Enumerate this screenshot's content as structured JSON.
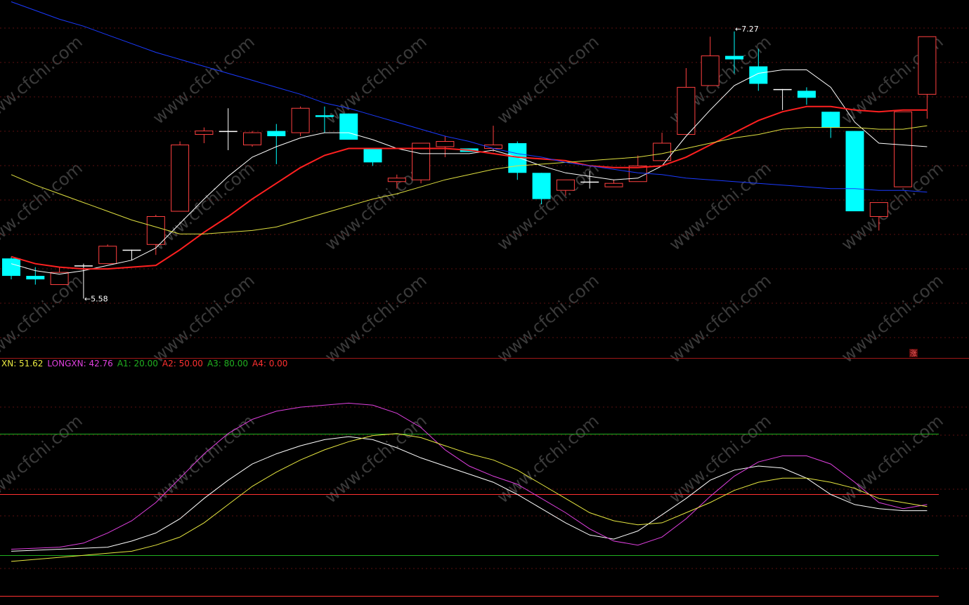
{
  "chart_data": [
    {
      "type": "candlestick",
      "title": "",
      "ylim": [
        5.4,
        7.45
      ],
      "candles": [
        {
          "o": 5.97,
          "h": 5.98,
          "l": 5.85,
          "c": 5.87
        },
        {
          "o": 5.87,
          "h": 5.92,
          "l": 5.82,
          "c": 5.85
        },
        {
          "o": 5.82,
          "h": 5.92,
          "l": 5.82,
          "c": 5.89
        },
        {
          "o": 5.93,
          "h": 5.94,
          "l": 5.74,
          "c": 5.93
        },
        {
          "o": 5.94,
          "h": 6.05,
          "l": 5.94,
          "c": 6.04
        },
        {
          "o": 6.02,
          "h": 6.02,
          "l": 5.96,
          "c": 6.02
        },
        {
          "o": 6.05,
          "h": 6.22,
          "l": 5.99,
          "c": 6.21
        },
        {
          "o": 6.24,
          "h": 6.64,
          "l": 6.24,
          "c": 6.62
        },
        {
          "o": 6.68,
          "h": 6.72,
          "l": 6.63,
          "c": 6.7
        },
        {
          "o": 6.7,
          "h": 6.83,
          "l": 6.59,
          "c": 6.7
        },
        {
          "o": 6.62,
          "h": 6.7,
          "l": 6.61,
          "c": 6.69
        },
        {
          "o": 6.7,
          "h": 6.74,
          "l": 6.51,
          "c": 6.67
        },
        {
          "o": 6.69,
          "h": 6.84,
          "l": 6.67,
          "c": 6.83
        },
        {
          "o": 6.79,
          "h": 6.84,
          "l": 6.69,
          "c": 6.78
        },
        {
          "o": 6.8,
          "h": 6.8,
          "l": 6.65,
          "c": 6.65
        },
        {
          "o": 6.6,
          "h": 6.6,
          "l": 6.5,
          "c": 6.52
        },
        {
          "o": 6.41,
          "h": 6.45,
          "l": 6.37,
          "c": 6.43
        },
        {
          "o": 6.42,
          "h": 6.63,
          "l": 6.4,
          "c": 6.63
        },
        {
          "o": 6.61,
          "h": 6.67,
          "l": 6.55,
          "c": 6.64
        },
        {
          "o": 6.6,
          "h": 6.6,
          "l": 6.58,
          "c": 6.58
        },
        {
          "o": 6.6,
          "h": 6.73,
          "l": 6.58,
          "c": 6.62
        },
        {
          "o": 6.63,
          "h": 6.64,
          "l": 6.42,
          "c": 6.46
        },
        {
          "o": 6.46,
          "h": 6.46,
          "l": 6.28,
          "c": 6.31
        },
        {
          "o": 6.36,
          "h": 6.42,
          "l": 6.33,
          "c": 6.42
        },
        {
          "o": 6.41,
          "h": 6.47,
          "l": 6.37,
          "c": 6.41
        },
        {
          "o": 6.38,
          "h": 6.42,
          "l": 6.38,
          "c": 6.4
        },
        {
          "o": 6.41,
          "h": 6.56,
          "l": 6.41,
          "c": 6.5
        },
        {
          "o": 6.53,
          "h": 6.69,
          "l": 6.53,
          "c": 6.63
        },
        {
          "o": 6.68,
          "h": 7.06,
          "l": 6.68,
          "c": 6.95
        },
        {
          "o": 6.96,
          "h": 7.24,
          "l": 6.96,
          "c": 7.13
        },
        {
          "o": 7.13,
          "h": 7.27,
          "l": 7.03,
          "c": 7.11
        },
        {
          "o": 7.07,
          "h": 7.17,
          "l": 6.93,
          "c": 6.97
        },
        {
          "o": 6.94,
          "h": 6.94,
          "l": 6.82,
          "c": 6.94
        },
        {
          "o": 6.93,
          "h": 6.95,
          "l": 6.85,
          "c": 6.89
        },
        {
          "o": 6.81,
          "h": 6.81,
          "l": 6.66,
          "c": 6.72
        },
        {
          "o": 6.7,
          "h": 6.7,
          "l": 6.24,
          "c": 6.24
        },
        {
          "o": 6.21,
          "h": 6.27,
          "l": 6.13,
          "c": 6.29
        },
        {
          "o": 6.38,
          "h": 6.81,
          "l": 6.38,
          "c": 6.81
        },
        {
          "o": 6.91,
          "h": 7.24,
          "l": 6.77,
          "c": 7.24
        }
      ],
      "series": [
        {
          "color": "#ffffff",
          "values": [
            5.94,
            5.9,
            5.88,
            5.9,
            5.93,
            5.96,
            6.03,
            6.17,
            6.31,
            6.44,
            6.55,
            6.61,
            6.66,
            6.69,
            6.69,
            6.65,
            6.6,
            6.57,
            6.57,
            6.57,
            6.59,
            6.55,
            6.5,
            6.46,
            6.44,
            6.42,
            6.43,
            6.5,
            6.67,
            6.82,
            6.96,
            7.03,
            7.05,
            7.05,
            6.95,
            6.75,
            6.63,
            6.62,
            6.61
          ]
        },
        {
          "color": "#ff2020",
          "width": 2,
          "values": [
            5.98,
            5.94,
            5.92,
            5.91,
            5.91,
            5.92,
            5.93,
            6.02,
            6.12,
            6.21,
            6.31,
            6.4,
            6.49,
            6.56,
            6.6,
            6.6,
            6.6,
            6.6,
            6.6,
            6.59,
            6.57,
            6.55,
            6.54,
            6.53,
            6.5,
            6.49,
            6.49,
            6.5,
            6.55,
            6.62,
            6.69,
            6.76,
            6.81,
            6.84,
            6.84,
            6.82,
            6.81,
            6.82,
            6.82
          ]
        },
        {
          "color": "#e0e040",
          "values": [
            6.45,
            6.39,
            6.34,
            6.29,
            6.24,
            6.19,
            6.15,
            6.11,
            6.11,
            6.12,
            6.13,
            6.15,
            6.19,
            6.23,
            6.27,
            6.31,
            6.34,
            6.38,
            6.42,
            6.45,
            6.48,
            6.5,
            6.51,
            6.52,
            6.53,
            6.54,
            6.55,
            6.57,
            6.6,
            6.63,
            6.66,
            6.68,
            6.71,
            6.72,
            6.72,
            6.72,
            6.71,
            6.71,
            6.73
          ]
        },
        {
          "color": "#1a3aff",
          "values": [
            7.44,
            7.39,
            7.34,
            7.3,
            7.25,
            7.2,
            7.15,
            7.11,
            7.07,
            7.03,
            6.99,
            6.95,
            6.91,
            6.86,
            6.83,
            6.79,
            6.75,
            6.71,
            6.67,
            6.64,
            6.6,
            6.57,
            6.55,
            6.52,
            6.5,
            6.48,
            6.46,
            6.45,
            6.43,
            6.42,
            6.41,
            6.4,
            6.39,
            6.38,
            6.37,
            6.37,
            6.36,
            6.36,
            6.35
          ]
        }
      ],
      "annotations": [
        {
          "label": "7.27",
          "candle": 30
        },
        {
          "label": "5.58",
          "candle": 3
        }
      ],
      "marker": "涨"
    },
    {
      "type": "line",
      "title": "",
      "ylim": [
        0,
        110
      ],
      "legend": [
        {
          "text": "XN: 51.62",
          "color": "#e8e840"
        },
        {
          "text": "LONGXN: 42.76",
          "color": "#e040e0"
        },
        {
          "text": "A1: 20.00",
          "color": "#20b020"
        },
        {
          "text": "A2: 50.00",
          "color": "#ff3030"
        },
        {
          "text": "A3: 80.00",
          "color": "#20b020"
        },
        {
          "text": "A4: 0.00",
          "color": "#ff3030"
        }
      ],
      "hlines": [
        {
          "value": 0,
          "color": "#ff3030"
        },
        {
          "value": 20,
          "color": "#20b020"
        },
        {
          "value": 50,
          "color": "#ff3030"
        },
        {
          "value": 80,
          "color": "#20b020"
        }
      ],
      "series": [
        {
          "color": "#ffffff",
          "values": [
            22,
            22.5,
            23,
            23.5,
            24,
            27,
            31,
            38,
            48,
            57,
            65,
            70,
            74,
            77,
            78.5,
            77,
            73,
            68,
            64,
            60,
            56,
            50,
            43,
            36,
            30,
            28,
            32,
            40,
            48,
            57,
            62,
            64,
            63,
            58,
            50,
            45,
            43,
            42,
            42
          ]
        },
        {
          "color": "#e040e0",
          "values": [
            23,
            23.5,
            24,
            26,
            31,
            37,
            46,
            58,
            70,
            80,
            87,
            91,
            93,
            94,
            95,
            94,
            90,
            83,
            72,
            64,
            59,
            55,
            48,
            41,
            33,
            27,
            25,
            29,
            38,
            49,
            59,
            66,
            69,
            69,
            65,
            56,
            46,
            43,
            45
          ]
        },
        {
          "color": "#e8e840",
          "values": [
            17,
            18,
            19,
            20,
            21,
            22,
            25,
            29,
            36,
            45,
            54,
            61,
            67,
            72,
            76,
            79,
            80,
            78,
            74,
            70,
            67,
            62,
            55,
            48,
            41,
            37,
            35,
            36,
            41,
            46,
            52,
            56,
            58,
            58,
            56,
            53,
            48,
            46,
            44
          ]
        }
      ]
    }
  ],
  "watermark": "www.cfchi.com"
}
